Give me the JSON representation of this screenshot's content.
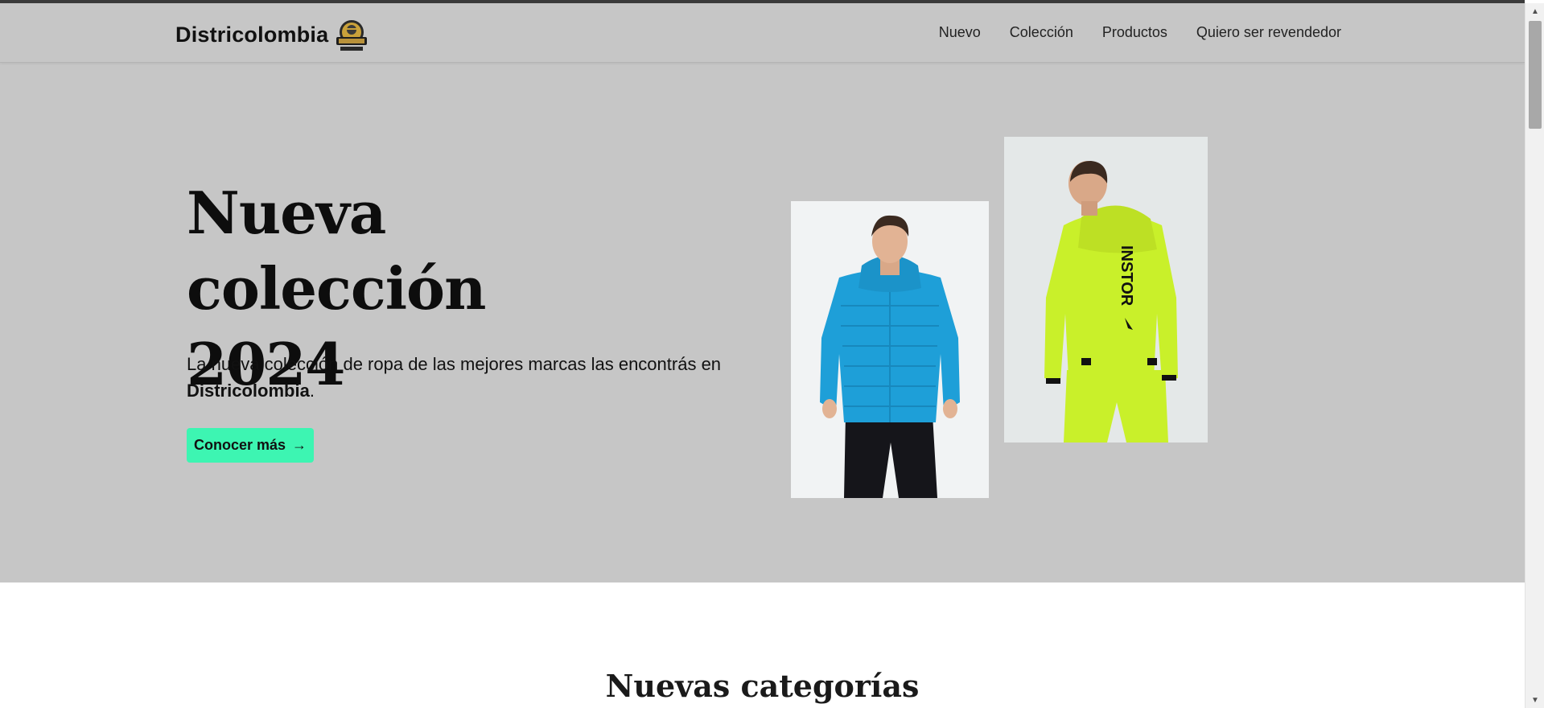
{
  "navbar": {
    "brand": "Districolombia",
    "logo_icon": "districolombia-logo-icon",
    "links": [
      "Nuevo",
      "Colección",
      "Productos",
      "Quiero ser revendedor"
    ]
  },
  "hero": {
    "title_line1": "Nueva colección",
    "title_line2": "2024",
    "text": "La nueva colección de ropa de las mejores marcas las encontrás en",
    "text_brand": "Districolombia",
    "text_end": ".",
    "cta_label": "Conocer más",
    "cta_icon": "arrow-right-icon",
    "cta_color": "#3df5b2",
    "background": "#c6c6c6",
    "images": [
      {
        "name": "model-blue-jacket-photo",
        "jacket_color": "#1e9fd8"
      },
      {
        "name": "model-green-jacket-photo",
        "jacket_color": "#c9f02a",
        "print": "INSTOR"
      }
    ]
  },
  "section": {
    "title": "Nuevas categorías"
  }
}
